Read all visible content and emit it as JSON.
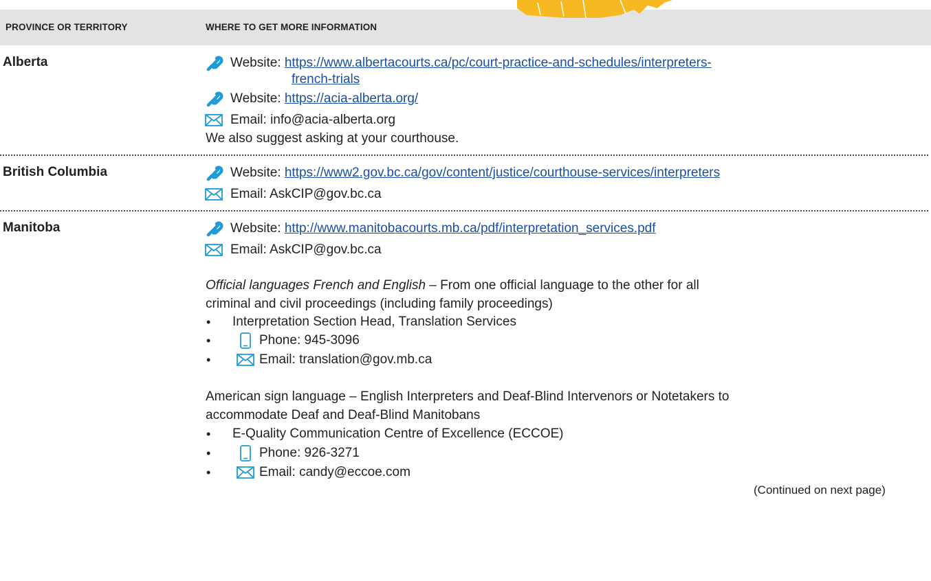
{
  "header": {
    "col1": "PROVINCE OR TERRITORY",
    "col2": "WHERE TO GET MORE INFORMATION"
  },
  "rows": {
    "alberta": {
      "name": "Alberta",
      "website_label": "Website:",
      "url1_line1": "https://www.albertacourts.ca/pc/court-practice-and-schedules/interpreters-",
      "url1_line2": "french-trials",
      "url2": "https://acia-alberta.org/",
      "email": "Email: info@acia-alberta.org",
      "note": "We also suggest asking at your courthouse."
    },
    "bc": {
      "name": "British Columbia",
      "website_label": "Website:",
      "url": "https://www2.gov.bc.ca/gov/content/justice/courthouse-services/interpreters",
      "email": "Email: AskCIP@gov.bc.ca"
    },
    "manitoba": {
      "name": "Manitoba",
      "website_label": "Website:",
      "url": "http://www.manitobacourts.mb.ca/pdf/interpretation_services.pdf",
      "email": "Email: AskCIP@gov.bc.ca",
      "official_lang_italic": "Official languages French and English",
      "official_lang_rest": " – From one official language to the other for all",
      "official_lang_line2": "criminal and civil proceedings (including family proceedings)",
      "official_items": [
        "Interpretation Section Head, Translation Services",
        "Phone: 945-3096",
        "Email: translation@gov.mb.ca"
      ],
      "asl_line1": "American sign language – English Interpreters and Deaf-Blind Intervenors or Notetakers to",
      "asl_line2": "accommodate Deaf and Deaf-Blind Manitobans",
      "asl_items": [
        "E-Quality Communication Centre of Excellence (ECCOE)",
        "Phone: 926-3271",
        "Email: candy@eccoe.com"
      ]
    }
  },
  "footer_note": "(Continued on next page)",
  "colors": {
    "header_bg": "#e3e3e3",
    "link": "#1a4fa0",
    "link_icon": "#1f9bd7",
    "map": "#f7b922",
    "text": "#231f20"
  }
}
